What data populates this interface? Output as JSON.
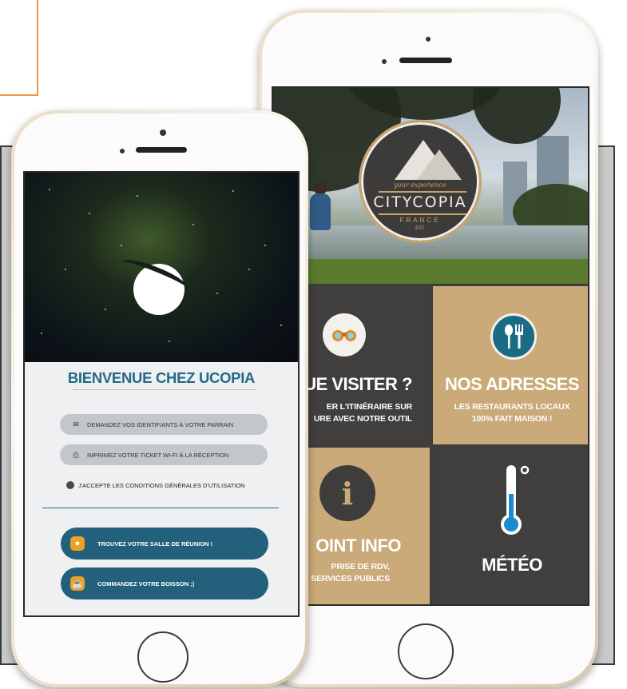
{
  "back_phone": {
    "hero": {
      "logo_tagline": "your experience",
      "logo_name": "CITYCOPIA",
      "logo_country": "FRANCE",
      "logo_year": "EST"
    },
    "tiles": [
      {
        "title": "UE VISITER ?",
        "subtitle": "ER L'ITINÉRAIRE SUR\nURE AVEC NOTRE OUTIL",
        "icon": "binoculars-icon"
      },
      {
        "title": "NOS ADRESSES",
        "subtitle": "LES RESTAURANTS LOCAUX\n100% FAIT MAISON !",
        "icon": "restaurant-icon"
      },
      {
        "title": "OINT INFO",
        "subtitle": "PRISE DE RDV,\nSERVICES PUBLICS",
        "icon": "info-icon"
      },
      {
        "title": "MÉTÉO",
        "subtitle": "",
        "icon": "thermometer-icon"
      }
    ]
  },
  "front_phone": {
    "welcome_title": "BIENVENUE CHEZ UCOPIA",
    "options": [
      {
        "label": "DEMANDEZ VOS IDENTIFIANTS À VOTRE PARRAIN",
        "icon": "mail-icon"
      },
      {
        "label": "IMPRIMEZ VOTRE TICKET WI-FI À LA RÉCEPTION",
        "icon": "printer-icon"
      }
    ],
    "terms_label": "J'ACCEPTE LES CONDITIONS GÉNÉRALES D'UTILISATION",
    "actions": [
      {
        "label": "TROUVEZ VOTRE SALLE DE RÉUNION !",
        "icon": "location-pin-icon"
      },
      {
        "label": "COMMANDEZ VOTRE BOISSON ;)",
        "icon": "coffee-cup-icon"
      }
    ]
  },
  "colors": {
    "accent_blue": "#23607c",
    "tile_tan": "#c9aa78",
    "tile_dark": "#403f3e",
    "orange_frame": "#e89a3c"
  }
}
